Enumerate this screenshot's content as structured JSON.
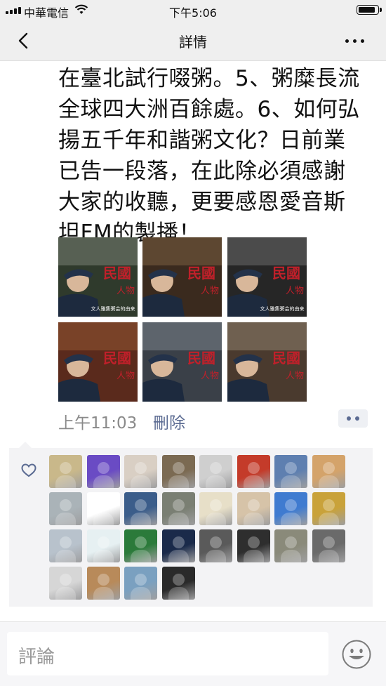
{
  "status_bar": {
    "carrier": "中華電信",
    "time": "下午5:06",
    "battery_level": 0.9
  },
  "nav": {
    "title": "詳情",
    "back_icon": "chevron-left-icon",
    "more_icon": "ellipsis-icon"
  },
  "post": {
    "text": "在臺北試行啜粥。5、粥糜長流\n全球四大洲百餘處。6、如何弘\n揚五千年和諧粥文化？日前業\n已告一段落，在此除必須感謝\n大家的收聽，更要感恩愛音斯\n坦FM的製播！",
    "photos": [
      {
        "title_art": "民國人物",
        "caption": "文人雅集粥会的由来",
        "bg": "#2f3a2c",
        "accent": "#cfd2c6"
      },
      {
        "title_art": "民國人物",
        "caption": "",
        "bg": "#3a2a1e",
        "accent": "#c8a16a"
      },
      {
        "title_art": "民國人物",
        "caption": "文人雅集粥会的由来",
        "bg": "#262626",
        "accent": "#bdbdbd"
      },
      {
        "title_art": "民國人物",
        "caption": "",
        "bg": "#5a2a1c",
        "accent": "#d68a4a"
      },
      {
        "title_art": "民國人物",
        "caption": "",
        "bg": "#3a4048",
        "accent": "#c9ced6"
      },
      {
        "title_art": "民國人物",
        "caption": "",
        "bg": "#4a3a2e",
        "accent": "#e0d2b8"
      }
    ],
    "timestamp": "上午11:03",
    "delete_label": "刪除"
  },
  "likes": {
    "heart_icon": "heart-outline-icon",
    "avatars": [
      "#c9b88a",
      "#6a4bc4",
      "#d9cfc4",
      "#7b6a52",
      "#cfcfcf",
      "#c43b2a",
      "#5e7fb0",
      "#d4a36a",
      "#aab3b8",
      "#ffffff",
      "#3b5d8a",
      "#7a7f73",
      "#e7dfc8",
      "#d6c3a8",
      "#3f7bd0",
      "#c9a23a",
      "#b8c2cc",
      "#e6f0f2",
      "#2b7a3a",
      "#1a2a4a",
      "#5a5a5a",
      "#2e2e2e",
      "#8a8a7a",
      "#6a6a6a",
      "#d6d6d6",
      "#b88a5a",
      "#7aa0c0",
      "#2a2a2a"
    ]
  },
  "comment_bar": {
    "placeholder": "評論",
    "emoji_icon": "smiley-face-icon"
  }
}
